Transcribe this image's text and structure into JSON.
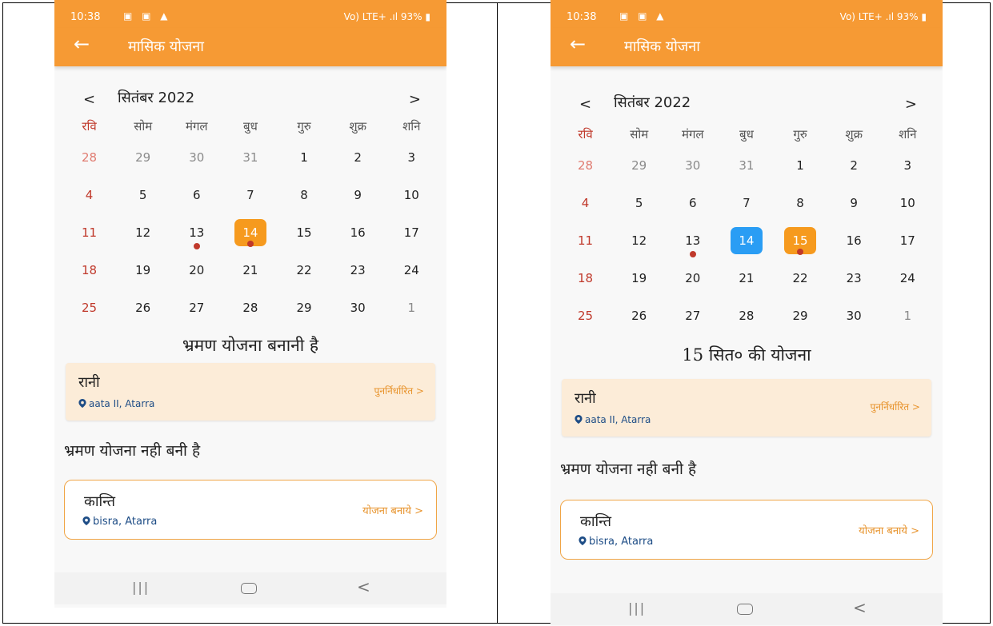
{
  "status": {
    "time": "10:38",
    "left_icons": "▣ ▣ ▲",
    "right_text": "Vo) LTE+ .ıl 93% ▮"
  },
  "appbar": {
    "back_glyph": "←",
    "title": "मासिक योजना"
  },
  "calendar": {
    "prev": "<",
    "next": ">",
    "month_label": "सितंबर 2022",
    "weekdays": [
      "रवि",
      "सोम",
      "मंगल",
      "बुध",
      "गुरु",
      "शुक्र",
      "शनि"
    ],
    "weeks": [
      [
        "28",
        "29",
        "30",
        "31",
        "1",
        "2",
        "3"
      ],
      [
        "4",
        "5",
        "6",
        "7",
        "8",
        "9",
        "10"
      ],
      [
        "11",
        "12",
        "13",
        "14",
        "15",
        "16",
        "17"
      ],
      [
        "18",
        "19",
        "20",
        "21",
        "22",
        "23",
        "24"
      ],
      [
        "25",
        "26",
        "27",
        "28",
        "29",
        "30",
        "1"
      ]
    ]
  },
  "left": {
    "section_title": "भ्रमण योजना बनानी है",
    "card1": {
      "name": "रानी",
      "location": "aata II, Atarra",
      "action": "पुनर्निर्धारित >"
    },
    "section_sub": "भ्रमण योजना नही बनी है",
    "card2": {
      "name": "कान्ति",
      "location": "bisra, Atarra",
      "action": "योजना बनाये >"
    }
  },
  "right": {
    "section_title": "15 सित० की योजना",
    "card1": {
      "name": "रानी",
      "location": "aata II, Atarra",
      "action": "पुनर्निर्धारित >"
    },
    "section_sub": "भ्रमण योजना नही बनी है",
    "card2": {
      "name": "कान्ति",
      "location": "bisra, Atarra",
      "action": "योजना बनाये >"
    }
  },
  "navbar": {
    "recents": "|||",
    "back": "<"
  },
  "colors": {
    "accent": "#f69a34",
    "selected_orange": "#f69a1e",
    "selected_blue": "#2a9df4",
    "sunday": "#c0392b",
    "location": "#1e4d86"
  },
  "icons": {
    "location": "map-pin-icon",
    "back": "arrow-left-icon",
    "home": "home-icon"
  }
}
